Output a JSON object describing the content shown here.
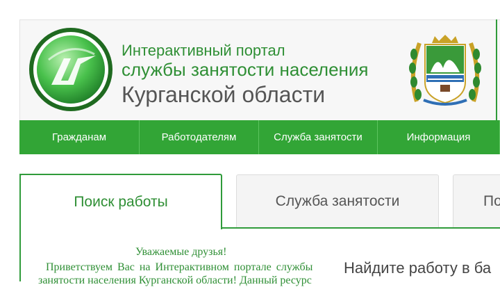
{
  "header": {
    "title_line1": "Интерактивный портал",
    "title_line2": "службы занятости населения",
    "title_line3": "Курганской области"
  },
  "nav": {
    "items": [
      {
        "label": "Гражданам"
      },
      {
        "label": "Работодателям"
      },
      {
        "label": "Служба занятости"
      },
      {
        "label": "Информация"
      }
    ]
  },
  "tabs": [
    {
      "label": "Поиск работы",
      "active": true
    },
    {
      "label": "Служба занятости",
      "active": false
    },
    {
      "label": "По",
      "active": false
    }
  ],
  "content": {
    "greeting": "Уважаемые друзья!",
    "paragraph_line1": "Приветствуем Вас на Интерактивном портале службы",
    "paragraph_line2": "занятости населения Курганской области! Данный ресурс",
    "find_heading": "Найдите работу в ба"
  },
  "colors": {
    "brand_green": "#32a536",
    "text_green": "#2f8f35",
    "text_gray": "#555555"
  },
  "icons": {
    "logo": "portal-logo-icon",
    "crest": "kurgan-coat-of-arms-icon"
  }
}
